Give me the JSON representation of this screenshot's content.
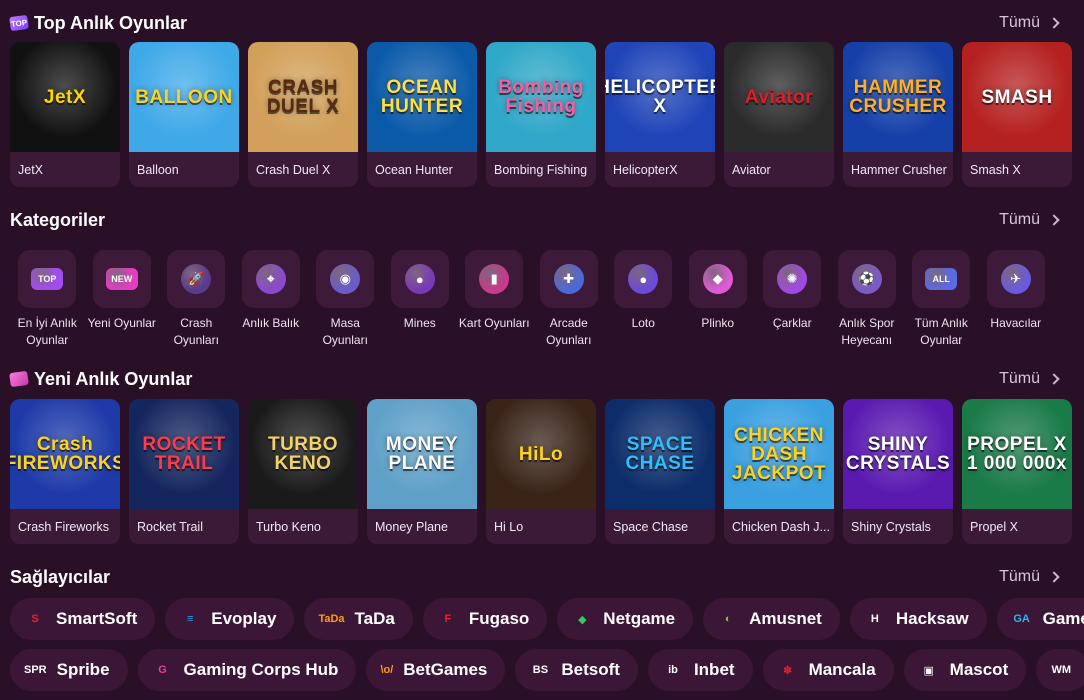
{
  "sections": {
    "top": {
      "title": "Top Anlık Oyunlar",
      "see_all": "Tümü"
    },
    "categories": {
      "title": "Kategoriler",
      "see_all": "Tümü"
    },
    "new": {
      "title": "Yeni Anlık Oyunlar",
      "see_all": "Tümü"
    },
    "providers": {
      "title": "Sağlayıcılar",
      "see_all": "Tümü"
    }
  },
  "top_games": [
    {
      "name": "JetX",
      "logo": "JetX",
      "bg": "#111111",
      "fg": "#ffd400"
    },
    {
      "name": "Balloon",
      "logo": "BALLOON",
      "bg": "#3fa9e8",
      "fg": "#ffd21c"
    },
    {
      "name": "Crash Duel X",
      "logo": "CRASH DUEL X",
      "bg": "#d2a05a",
      "fg": "#5a2a0c"
    },
    {
      "name": "Ocean Hunter",
      "logo": "OCEAN HUNTER",
      "bg": "#0a5aa8",
      "fg": "#ffe040"
    },
    {
      "name": "Bombing Fishing",
      "logo": "Bombing Fishing",
      "bg": "#2fa7c8",
      "fg": "#ff5aa0"
    },
    {
      "name": "HelicopterX",
      "logo": "HELICOPTER X",
      "bg": "#1f44b8",
      "fg": "#ffffff"
    },
    {
      "name": "Aviator",
      "logo": "Aviator",
      "bg": "#2a2a2a",
      "fg": "#e01b2a"
    },
    {
      "name": "Hammer Crusher",
      "logo": "HAMMER CRUSHER",
      "bg": "#1540a8",
      "fg": "#ffb020"
    },
    {
      "name": "Smash X",
      "logo": "SMASH",
      "bg": "#b52020",
      "fg": "#ffffff"
    }
  ],
  "categories": [
    {
      "label": "En İyi Anlık Oyunlar",
      "icon": "top-badge-icon",
      "glyph": "TOP",
      "color": "#a24cf0"
    },
    {
      "label": "Yeni Oyunlar",
      "icon": "new-badge-icon",
      "glyph": "NEW",
      "color": "#e43dc0"
    },
    {
      "label": "Crash Oyunları",
      "icon": "rocket-icon",
      "glyph": "🚀",
      "color": "#5c3a8a"
    },
    {
      "label": "Anlık Balık",
      "icon": "crosshair-icon",
      "glyph": "⌖",
      "color": "#8a4ad0"
    },
    {
      "label": "Masa Oyunları",
      "icon": "table-game-icon",
      "glyph": "◉",
      "color": "#6b5cc8"
    },
    {
      "label": "Mines",
      "icon": "bomb-icon",
      "glyph": "●",
      "color": "#7a3ab8"
    },
    {
      "label": "Kart Oyunları",
      "icon": "cards-icon",
      "glyph": "▮",
      "color": "#c83a8a"
    },
    {
      "label": "Arcade Oyunları",
      "icon": "joystick-icon",
      "glyph": "✚",
      "color": "#4a6ad8"
    },
    {
      "label": "Loto",
      "icon": "lotto-ball-icon",
      "glyph": "●",
      "color": "#6a4ad8"
    },
    {
      "label": "Plinko",
      "icon": "plinko-icon",
      "glyph": "◆",
      "color": "#e05ad8"
    },
    {
      "label": "Çarklar",
      "icon": "wheel-icon",
      "glyph": "✺",
      "color": "#a04ae0"
    },
    {
      "label": "Anlık Spor Heyecanı",
      "icon": "sports-icon",
      "glyph": "⚽",
      "color": "#7a5ac8"
    },
    {
      "label": "Tüm Anlık Oyunlar",
      "icon": "all-badge-icon",
      "glyph": "ALL",
      "color": "#5a6ae0"
    },
    {
      "label": "Havacılar",
      "icon": "plane-icon",
      "glyph": "✈",
      "color": "#6a5ae0"
    }
  ],
  "new_games": [
    {
      "name": "Crash Fireworks",
      "logo": "Crash FIREWORKS",
      "bg": "#1d3aa8",
      "fg": "#ffd21c"
    },
    {
      "name": "Rocket Trail",
      "logo": "ROCKET TRAIL",
      "bg": "#14265e",
      "fg": "#ff3a4a"
    },
    {
      "name": "Turbo Keno",
      "logo": "TURBO KENO",
      "bg": "#1a1a1a",
      "fg": "#f1d36a"
    },
    {
      "name": "Money Plane",
      "logo": "MONEY PLANE",
      "bg": "#5fa0c8",
      "fg": "#ffffff"
    },
    {
      "name": "Hi Lo",
      "logo": "HiLo",
      "bg": "#3a2418",
      "fg": "#ffd21c"
    },
    {
      "name": "Space Chase",
      "logo": "SPACE CHASE",
      "bg": "#0c2c6a",
      "fg": "#2ac0ff"
    },
    {
      "name": "Chicken Dash J...",
      "logo": "CHICKEN DASH JACKPOT",
      "bg": "#3aa0e0",
      "fg": "#ffd21c"
    },
    {
      "name": "Shiny Crystals",
      "logo": "SHINY CRYSTALS",
      "bg": "#5a1ab0",
      "fg": "#ffffff"
    },
    {
      "name": "Propel X",
      "logo": "PROPEL X 1 000 000x",
      "bg": "#1a7a48",
      "fg": "#ffffff"
    }
  ],
  "providers_row1": [
    {
      "name": "SmartSoft",
      "icon": "smartsoft-logo-icon",
      "glyph": "S",
      "color": "#e8242c"
    },
    {
      "name": "Evoplay",
      "icon": "evoplay-logo-icon",
      "glyph": "≡",
      "color": "#2a9ae8"
    },
    {
      "name": "TaDa",
      "icon": "tada-logo-icon",
      "glyph": "TaDa",
      "color": "#ff9a1a"
    },
    {
      "name": "Fugaso",
      "icon": "fugaso-logo-icon",
      "glyph": "F",
      "color": "#e8242c"
    },
    {
      "name": "Netgame",
      "icon": "netgame-logo-icon",
      "glyph": "◆",
      "color": "#3ac85a"
    },
    {
      "name": "Amusnet",
      "icon": "amusnet-logo-icon",
      "glyph": "◐",
      "color": "#7ac82a"
    },
    {
      "name": "Hacksaw",
      "icon": "hacksaw-logo-icon",
      "glyph": "H",
      "color": "#ffffff"
    },
    {
      "name": "Game",
      "icon": "game-logo-icon",
      "glyph": "GA",
      "color": "#3ab0e8"
    }
  ],
  "providers_row2": [
    {
      "name": "Spribe",
      "icon": "spribe-logo-icon",
      "glyph": "SPR",
      "color": "#ffffff"
    },
    {
      "name": "Gaming Corps Hub",
      "icon": "gaming-corps-logo-icon",
      "glyph": "G",
      "color": "#e83aa0"
    },
    {
      "name": "BetGames",
      "icon": "betgames-logo-icon",
      "glyph": "\\o/",
      "color": "#ff9a1a"
    },
    {
      "name": "Betsoft",
      "icon": "betsoft-logo-icon",
      "glyph": "BS",
      "color": "#ffffff"
    },
    {
      "name": "Inbet",
      "icon": "inbet-logo-icon",
      "glyph": "ib",
      "color": "#ffffff"
    },
    {
      "name": "Mancala",
      "icon": "mancala-logo-icon",
      "glyph": "✽",
      "color": "#e8242c"
    },
    {
      "name": "Mascot",
      "icon": "mascot-logo-icon",
      "glyph": "▣",
      "color": "#ffffff"
    },
    {
      "name": "",
      "icon": "wm-logo-icon",
      "glyph": "WM",
      "color": "#ffffff"
    }
  ]
}
